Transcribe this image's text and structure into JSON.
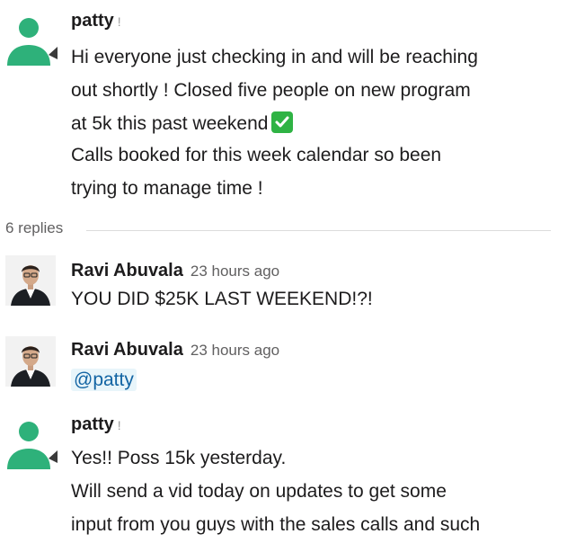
{
  "thread": {
    "parent": {
      "author": "patty",
      "status_mark": "!",
      "lines": [
        "Hi everyone just checking in and will be reaching",
        "out shortly ! Closed five people on new program",
        "at 5k this past weekend",
        "Calls booked for this week calendar so been",
        "trying to manage time !"
      ],
      "emoji": "white-check-mark-emoji"
    },
    "replies_label": "6 replies",
    "replies": [
      {
        "author": "Ravi Abuvala",
        "time": "23 hours ago",
        "text": "YOU DID $25K LAST WEEKEND!?!"
      },
      {
        "author": "Ravi Abuvala",
        "time": "23 hours ago",
        "mention": "@patty"
      },
      {
        "author": "patty",
        "status_mark": "!",
        "lines": [
          "Yes!! Poss 15k yesterday.",
          "Will send a vid today on updates to get some",
          "input from you guys with the sales calls and such"
        ]
      }
    ]
  },
  "colors": {
    "default_avatar": "#2eb17a",
    "check_emoji": "#2fb344",
    "mention_bg": "#e8f5fa",
    "mention_text": "#1264a3",
    "muted_text": "#616061"
  },
  "icons": {
    "default_avatar": "user-silhouette-icon",
    "ravi_avatar": "user-photo-avatar"
  }
}
